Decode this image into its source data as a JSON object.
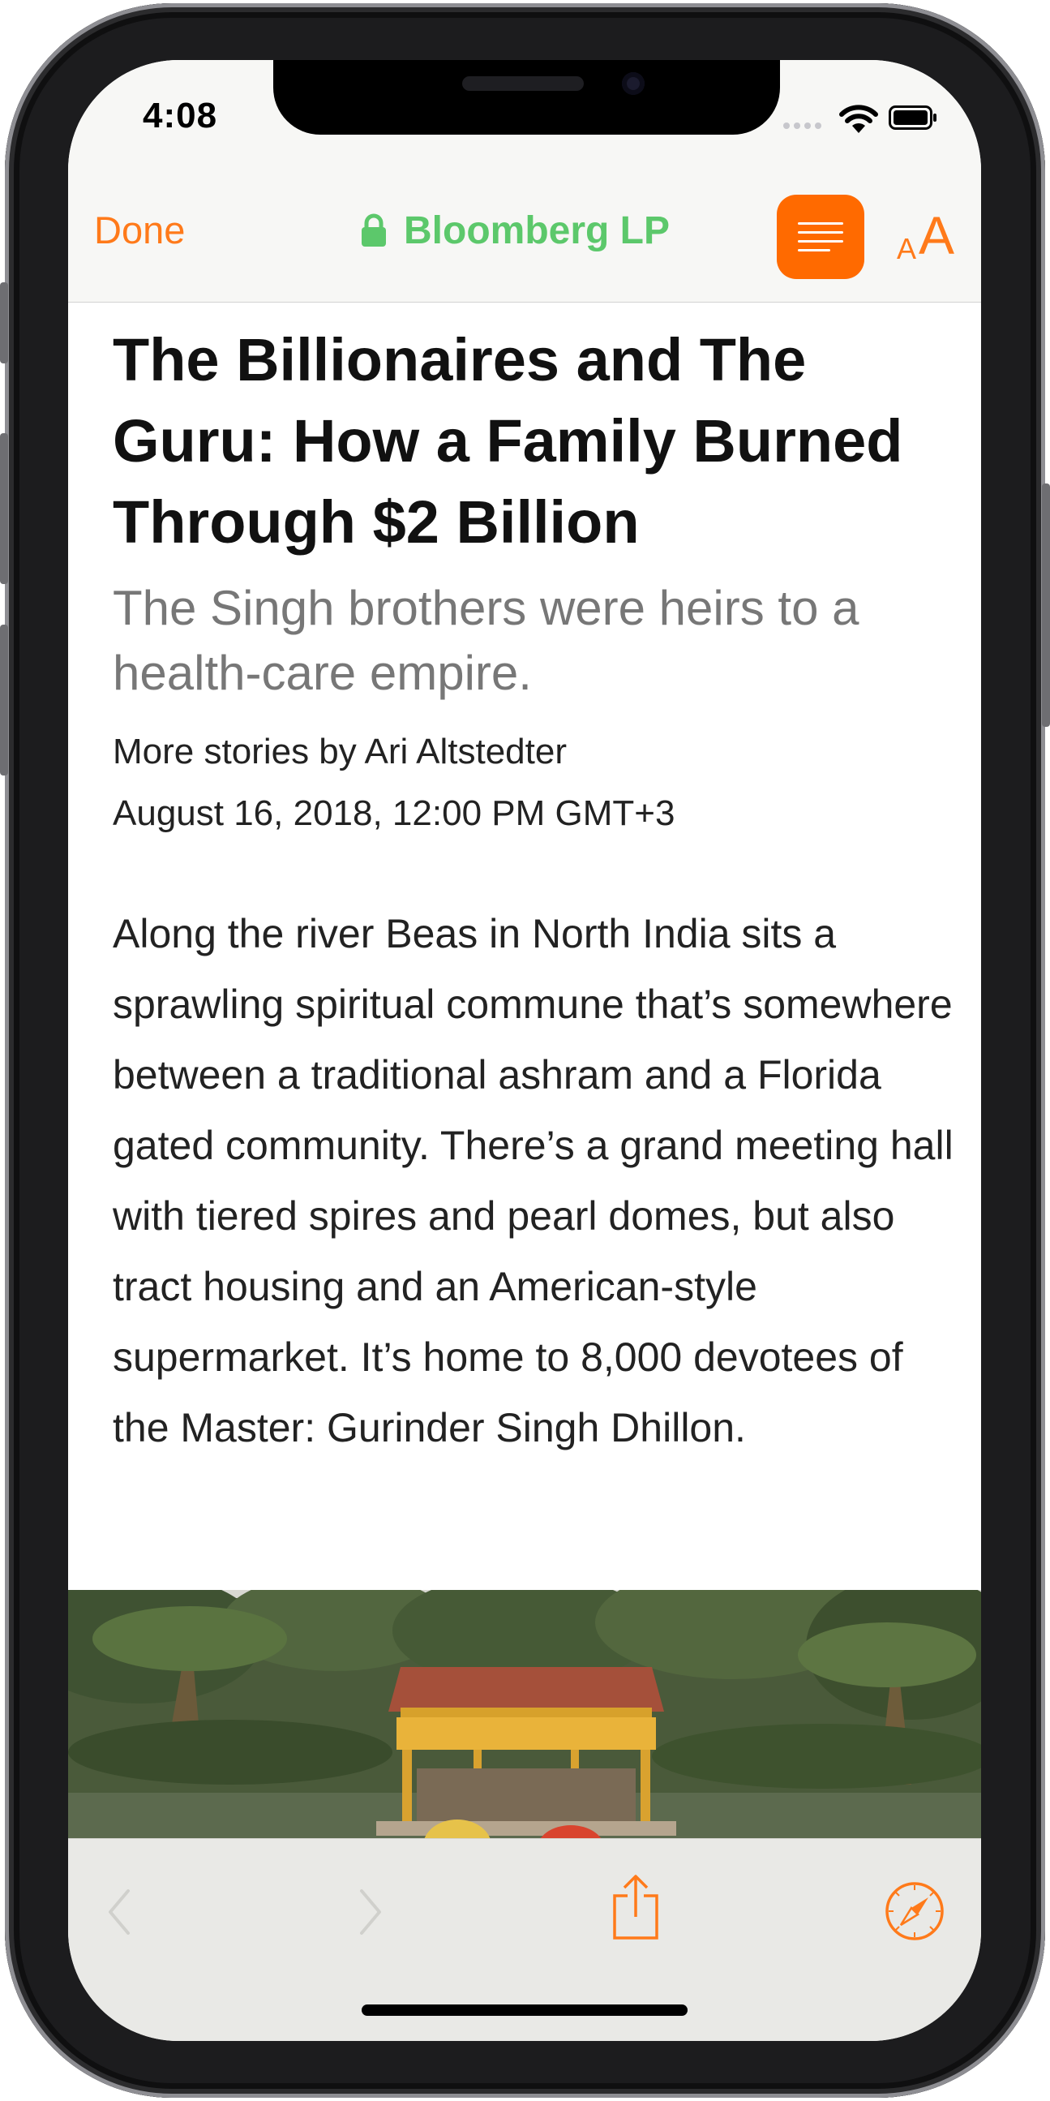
{
  "status_bar": {
    "time": "4:08"
  },
  "nav": {
    "done_label": "Done",
    "site_name": "Bloomberg LP",
    "reader_icon": "reader-view-icon",
    "text_size_small": "A",
    "text_size_large": "A"
  },
  "article": {
    "title": "The Billionaires and The Guru: How a Family Burned Through $2 Billion",
    "subtitle": "The Singh brothers were heirs to a health-care empire.",
    "byline": "More stories by Ari Altstedter",
    "date": "August 16, 2018, 12:00 PM GMT+3",
    "body": "Along the river Beas in North India sits a sprawling spiritual commune that’s somewhere between a traditional ashram and a Florida gated community. There’s a grand meeting hall with tiered spires and pearl domes, but also tract housing and an American-style supermarket. It’s home to 8,000 devotees of the Master: Gurinder Singh Dhillon."
  },
  "toolbar": {
    "back_icon": "chevron-left-icon",
    "forward_icon": "chevron-right-icon",
    "share_icon": "share-icon",
    "safari_icon": "compass-icon"
  },
  "colors": {
    "accent": "#ff7a1a",
    "secure_green": "#5cc86b",
    "reader_button": "#ff6a00"
  }
}
